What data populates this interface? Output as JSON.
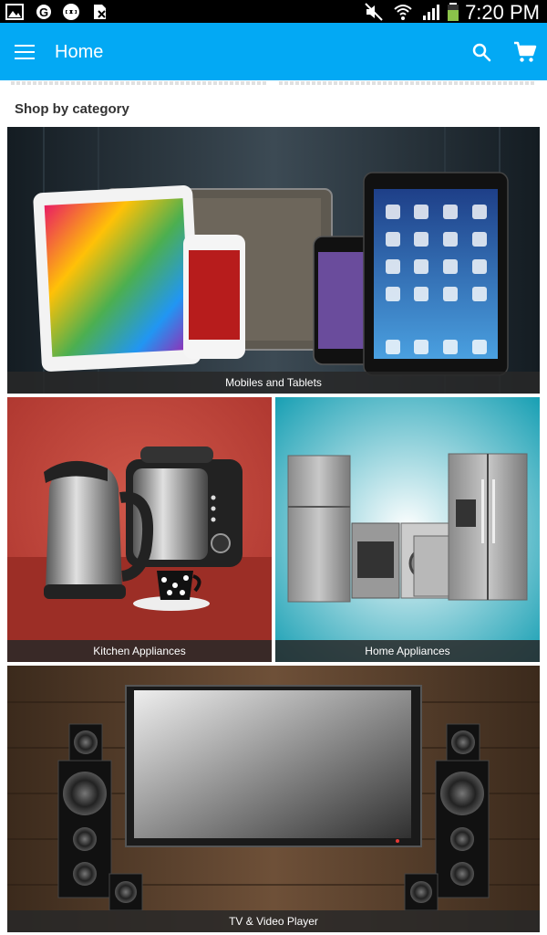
{
  "status_bar": {
    "time": "7:20 PM",
    "icons": [
      "gallery-icon",
      "g-icon",
      "incognito-icon",
      "sim-x-icon",
      "mute-icon",
      "wifi-icon",
      "signal-icon",
      "battery-icon"
    ]
  },
  "app_bar": {
    "title": "Home",
    "icons": [
      "menu-icon",
      "search-icon",
      "cart-icon"
    ],
    "color": "#03a9f4"
  },
  "section": {
    "title": "Shop by category"
  },
  "categories": [
    {
      "label": "Mobiles and Tablets"
    },
    {
      "label": "Kitchen Appliances"
    },
    {
      "label": "Home Appliances"
    },
    {
      "label": "TV & Video Player"
    }
  ]
}
